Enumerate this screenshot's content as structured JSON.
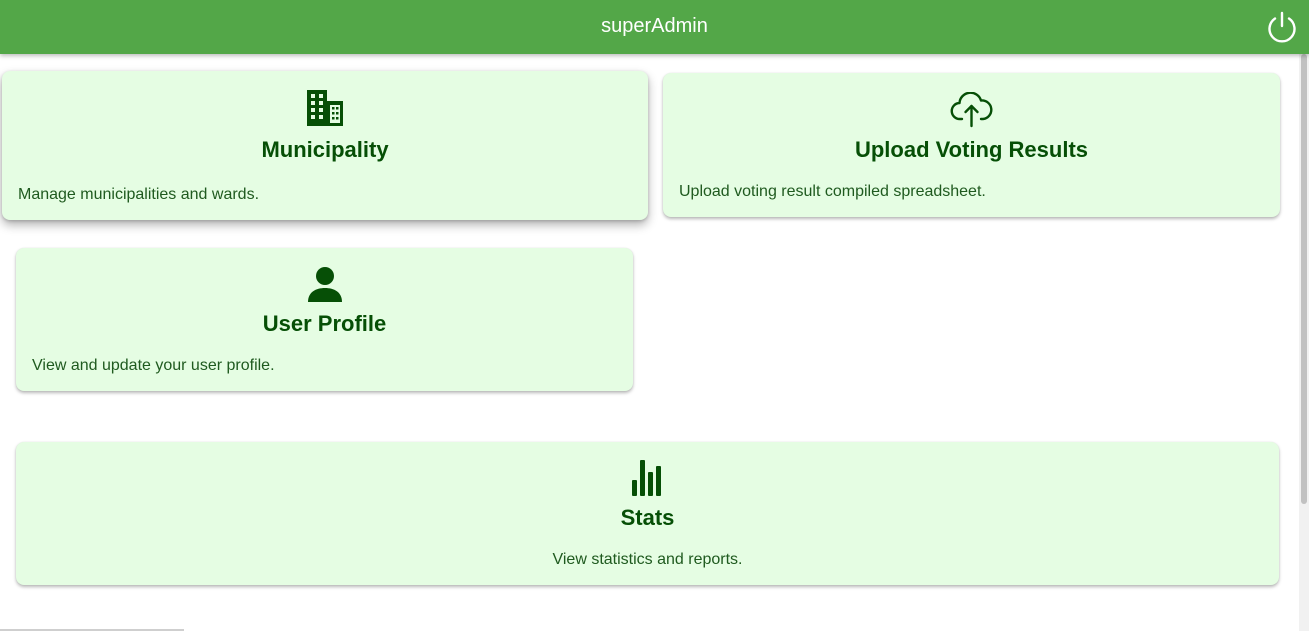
{
  "header": {
    "title": "superAdmin",
    "power_icon": "power-icon",
    "background_color": "#53a748"
  },
  "cards": [
    {
      "icon": "building-icon",
      "title": "Municipality",
      "description": "Manage municipalities and wards."
    },
    {
      "icon": "cloud-upload-icon",
      "title": "Upload Voting Results",
      "description": "Upload voting result compiled spreadsheet."
    },
    {
      "icon": "person-icon",
      "title": "User Profile",
      "description": "View and update your user profile."
    },
    {
      "icon": "bar-chart-icon",
      "title": "Stats",
      "description": "View statistics and reports."
    }
  ],
  "colors": {
    "card_background": "#e5fde3",
    "card_text": "#064f06"
  }
}
